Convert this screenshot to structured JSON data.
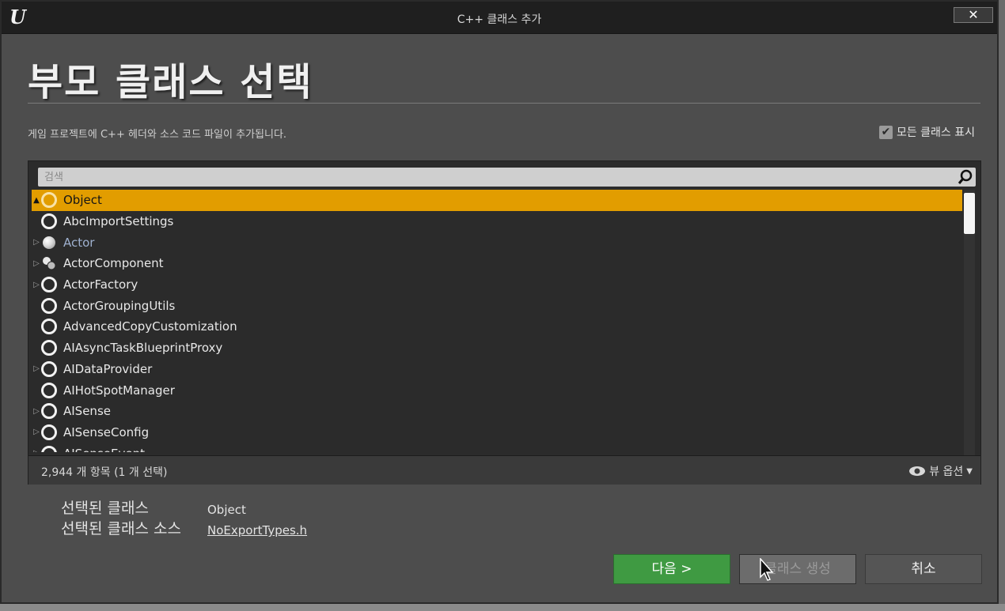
{
  "window": {
    "title": "C++ 클래스 추가",
    "close_label": "✕"
  },
  "header": {
    "heading": "부모 클래스 선택",
    "description": "게임 프로젝트에 C++ 헤더와 소스 코드 파일이 추가됩니다.",
    "show_all_label": "모든 클래스 표시",
    "show_all_checked": true
  },
  "search": {
    "placeholder": "검색",
    "value": ""
  },
  "tree": {
    "items": [
      {
        "label": "Object",
        "expander": "▲",
        "icon": "ring",
        "selected": true
      },
      {
        "label": "AbcImportSettings",
        "expander": "",
        "icon": "ring"
      },
      {
        "label": "Actor",
        "expander": "▷",
        "icon": "ball"
      },
      {
        "label": "ActorComponent",
        "expander": "▷",
        "icon": "component"
      },
      {
        "label": "ActorFactory",
        "expander": "▷",
        "icon": "ring"
      },
      {
        "label": "ActorGroupingUtils",
        "expander": "",
        "icon": "ring"
      },
      {
        "label": "AdvancedCopyCustomization",
        "expander": "",
        "icon": "ring"
      },
      {
        "label": "AIAsyncTaskBlueprintProxy",
        "expander": "",
        "icon": "ring"
      },
      {
        "label": "AIDataProvider",
        "expander": "▷",
        "icon": "ring"
      },
      {
        "label": "AIHotSpotManager",
        "expander": "",
        "icon": "ring"
      },
      {
        "label": "AISense",
        "expander": "▷",
        "icon": "ring"
      },
      {
        "label": "AISenseConfig",
        "expander": "▷",
        "icon": "ring"
      },
      {
        "label": "AISenseEvent",
        "expander": "▷",
        "icon": "ring"
      }
    ]
  },
  "status": {
    "count_text": "2,944 개 항목 (1 개 선택)",
    "view_options_label": "뷰 옵션"
  },
  "selection": {
    "class_label": "선택된 클래스",
    "class_value": "Object",
    "source_label": "선택된 클래스 소스",
    "source_value": "NoExportTypes.h"
  },
  "buttons": {
    "next": "다음 >",
    "create": "클래스 생성",
    "cancel": "취소"
  },
  "colors": {
    "selection_highlight": "#e29d00",
    "next_button": "#3f9a42"
  }
}
